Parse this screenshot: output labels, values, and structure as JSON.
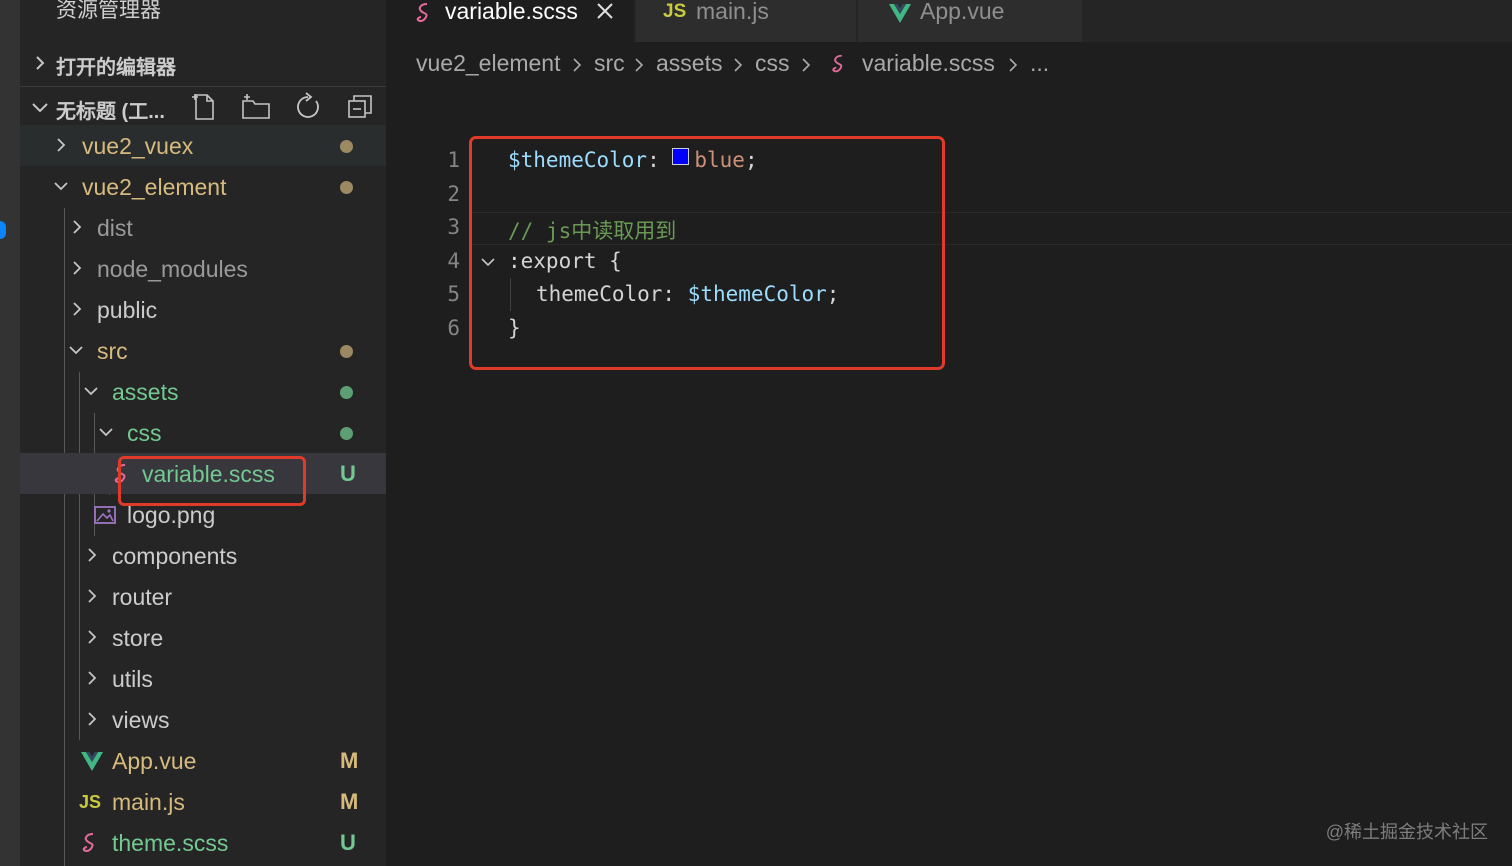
{
  "sidebar": {
    "title": "资源管理器",
    "open_editors_label": "打开的编辑器",
    "workspace_label": "无标题 (工..."
  },
  "tree": {
    "vue2_vuex": "vue2_vuex",
    "vue2_element": "vue2_element",
    "dist": "dist",
    "node_modules": "node_modules",
    "public": "public",
    "src": "src",
    "assets": "assets",
    "css": "css",
    "variable_scss": "variable.scss",
    "variable_scss_status": "U",
    "logo_png": "logo.png",
    "components": "components",
    "router": "router",
    "store": "store",
    "utils": "utils",
    "views": "views",
    "app_vue": "App.vue",
    "app_vue_status": "M",
    "main_js": "main.js",
    "main_js_status": "M",
    "theme_scss": "theme.scss",
    "theme_scss_status": "U"
  },
  "tabs": {
    "variable_scss": "variable.scss",
    "main_js": "main.js",
    "main_js_icon": "JS",
    "app_vue": "App.vue"
  },
  "breadcrumb": {
    "project": "vue2_element",
    "src": "src",
    "assets": "assets",
    "css": "css",
    "file": "variable.scss",
    "more": "..."
  },
  "editor": {
    "line_numbers": [
      "1",
      "2",
      "3",
      "4",
      "5",
      "6"
    ],
    "line1_var": "$themeColor",
    "line1_colon": ": ",
    "line1_value": "blue",
    "line1_semicolon": ";",
    "line3_comment": "// js中读取用到",
    "line4_code": ":export {",
    "line5_prop": "themeColor: ",
    "line5_var": "$themeColor",
    "line5_semicolon": ";",
    "line6_code": "}",
    "swatch_color": "#0000ff"
  },
  "colors": {
    "modified": "#d7ba7d",
    "untracked": "#73c991",
    "annotation": "#e03a2a",
    "sass_icon": "#e36b9b",
    "vue_icon": "#41b883",
    "js_icon": "#cbcb41"
  },
  "watermark": "@稀土掘金技术社区"
}
